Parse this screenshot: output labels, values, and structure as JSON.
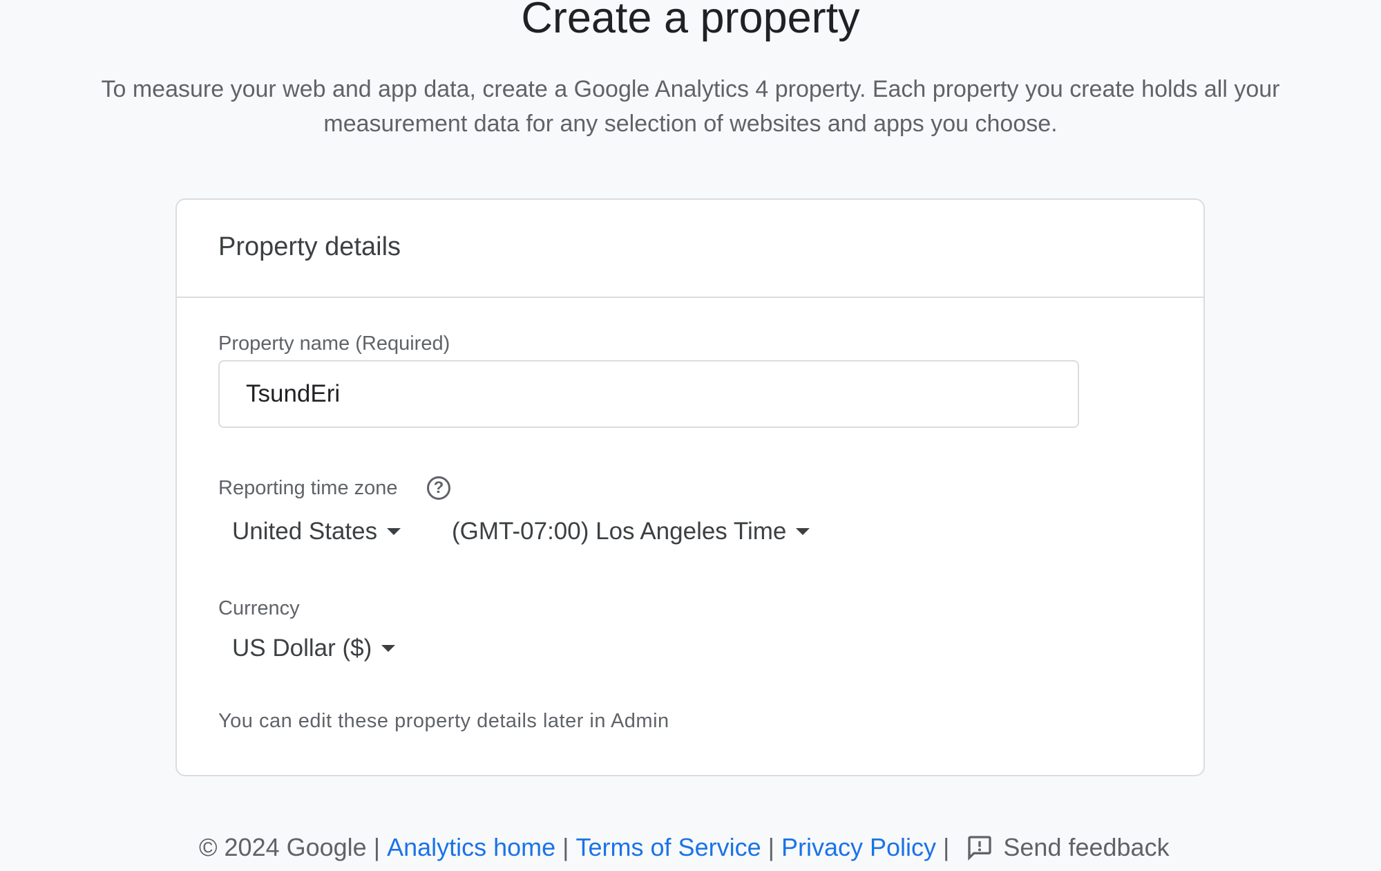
{
  "page": {
    "title": "Create a property",
    "intro": "To measure your web and app data, create a Google Analytics 4 property. Each property you create holds all your measurement data for any selection of websites and apps you choose."
  },
  "card": {
    "title": "Property details",
    "property_name_label": "Property name (Required)",
    "property_name_value": "TsundEri",
    "timezone_label": "Reporting time zone",
    "country_value": "United States",
    "timezone_value": "(GMT-07:00) Los Angeles Time",
    "currency_label": "Currency",
    "currency_value": "US Dollar ($)",
    "note": "You can edit these property details later in Admin"
  },
  "footer": {
    "copyright": "© 2024 Google",
    "separator": "|",
    "links": [
      "Analytics home",
      "Terms of Service",
      "Privacy Policy"
    ],
    "feedback": "Send feedback"
  },
  "icons": {
    "help": "help-circle-icon",
    "feedback": "feedback-icon",
    "dropdown": "chevron-down-icon"
  },
  "colors": {
    "background": "#f8f9fa",
    "link": "#1a73e8",
    "border": "#dadce0"
  }
}
